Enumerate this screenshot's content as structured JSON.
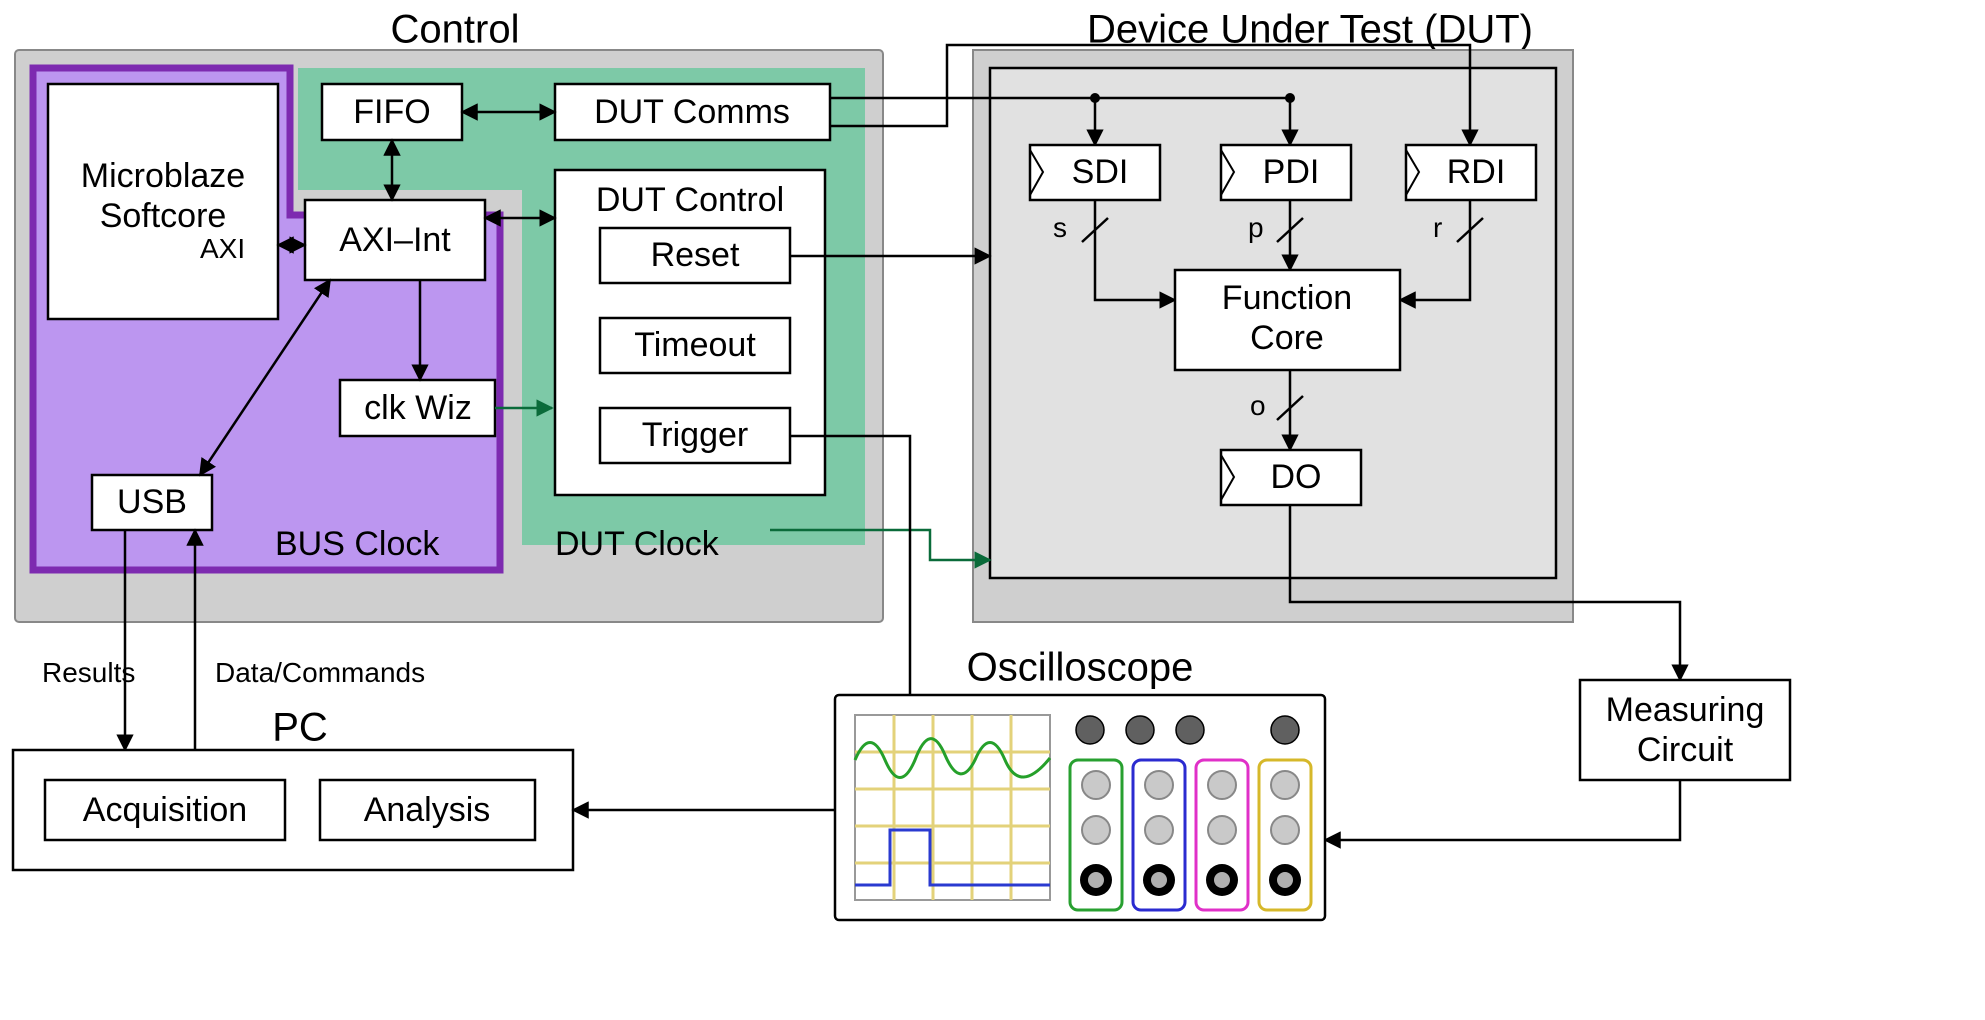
{
  "regions": {
    "control": {
      "title": "Control"
    },
    "bus_clock": {
      "label": "BUS Clock"
    },
    "dut_clock": {
      "label": "DUT Clock"
    },
    "dut_region": {
      "title": "Device Under Test (DUT)"
    },
    "pc": {
      "title": "PC"
    },
    "oscilloscope": {
      "title": "Oscilloscope"
    }
  },
  "blocks": {
    "microblaze": {
      "line1": "Microblaze",
      "line2": "Softcore",
      "port": "AXI"
    },
    "fifo": "FIFO",
    "axi_int": "AXI–Int",
    "dut_comms": "DUT Comms",
    "dut_control": {
      "label": "DUT Control",
      "reset": "Reset",
      "timeout": "Timeout",
      "trigger": "Trigger"
    },
    "clk_wiz": "clk Wiz",
    "usb": "USB",
    "acquisition": "Acquisition",
    "analysis": "Analysis",
    "measuring": {
      "line1": "Measuring",
      "line2": "Circuit"
    },
    "sdi": "SDI",
    "pdi": "PDI",
    "rdi": "RDI",
    "function_core": {
      "line1": "Function",
      "line2": "Core"
    },
    "do": "DO"
  },
  "signals": {
    "s": "s",
    "p": "p",
    "r": "r",
    "o": "o"
  },
  "arrows": {
    "results": "Results",
    "data_commands": "Data/Commands"
  },
  "colors": {
    "control_bg": "#cfcfcf",
    "bus_clock_bg": "#bc96f0",
    "bus_clock_border": "#7d2bb0",
    "dut_clock_bg": "#7dc9a7",
    "dut_inner_bg": "#e1e1e1",
    "knob": "#606060",
    "scope_grid": "#e3d27a",
    "scope_green": "#25a02a",
    "scope_blue": "#2a3ad0",
    "port_colors": [
      "#28a030",
      "#2b2bd0",
      "#e030c8",
      "#d6b82a"
    ]
  }
}
